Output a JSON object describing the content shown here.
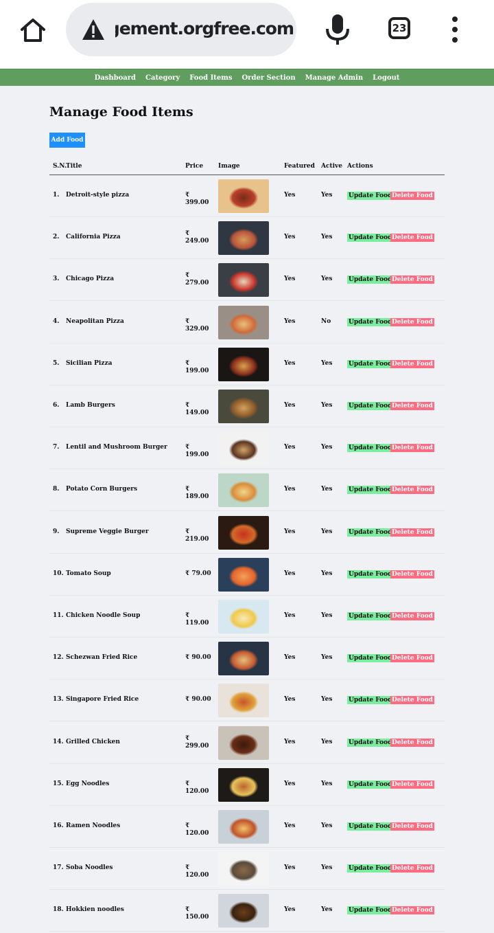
{
  "browser": {
    "url": "restaurant-management.orgfree.com",
    "tab_count": "23",
    "icons": [
      "home-icon",
      "warning-icon",
      "mic-icon",
      "tabs-icon",
      "menu-icon"
    ]
  },
  "nav": {
    "items": [
      "Dashboard",
      "Category",
      "Food Items",
      "Order Section",
      "Manage Admin",
      "Logout"
    ]
  },
  "page": {
    "title": "Manage Food Items",
    "add_button": "Add Food"
  },
  "table": {
    "headers": {
      "sn": "S.N.",
      "title": "Title",
      "price": "Price",
      "image": "Image",
      "featured": "Featured",
      "active": "Active",
      "actions": "Actions"
    },
    "update_label": "Update Food",
    "delete_label": "Delete Food",
    "rows": [
      {
        "sn": "1.",
        "title": "Detroit-style pizza",
        "price": "₹ 399.00",
        "featured": "Yes",
        "active": "Yes",
        "img": "pizza-squares"
      },
      {
        "sn": "2.",
        "title": "California Pizza",
        "price": "₹ 249.00",
        "featured": "Yes",
        "active": "Yes",
        "img": "pizza-round"
      },
      {
        "sn": "3.",
        "title": "Chicago Pizza",
        "price": "₹ 279.00",
        "featured": "Yes",
        "active": "Yes",
        "img": "deep-dish"
      },
      {
        "sn": "4.",
        "title": "Neapolitan Pizza",
        "price": "₹ 329.00",
        "featured": "Yes",
        "active": "No",
        "img": "pizza-margherita"
      },
      {
        "sn": "5.",
        "title": "Sicilian Pizza",
        "price": "₹ 199.00",
        "featured": "Yes",
        "active": "Yes",
        "img": "pizza-tray"
      },
      {
        "sn": "6.",
        "title": "Lamb Burgers",
        "price": "₹ 149.00",
        "featured": "Yes",
        "active": "Yes",
        "img": "burger-lamb"
      },
      {
        "sn": "7.",
        "title": "Lentil and Mushroom Burger",
        "price": "₹ 199.00",
        "featured": "Yes",
        "active": "Yes",
        "img": "burger-lentil"
      },
      {
        "sn": "8.",
        "title": "Potato Corn Burgers",
        "price": "₹ 189.00",
        "featured": "Yes",
        "active": "Yes",
        "img": "burger-potato"
      },
      {
        "sn": "9.",
        "title": "Supreme Veggie Burger",
        "price": "₹ 219.00",
        "featured": "Yes",
        "active": "Yes",
        "img": "burger-veggie"
      },
      {
        "sn": "10.",
        "title": "Tomato Soup",
        "price": "₹ 79.00",
        "featured": "Yes",
        "active": "Yes",
        "img": "soup-tomato"
      },
      {
        "sn": "11.",
        "title": "Chicken Noodle Soup",
        "price": "₹ 119.00",
        "featured": "Yes",
        "active": "Yes",
        "img": "soup-chicken"
      },
      {
        "sn": "12.",
        "title": "Schezwan Fried Rice",
        "price": "₹ 90.00",
        "featured": "Yes",
        "active": "Yes",
        "img": "rice-schezwan"
      },
      {
        "sn": "13.",
        "title": "Singapore Fried Rice",
        "price": "₹ 90.00",
        "featured": "Yes",
        "active": "Yes",
        "img": "rice-singapore"
      },
      {
        "sn": "14.",
        "title": "Grilled Chicken",
        "price": "₹ 299.00",
        "featured": "Yes",
        "active": "Yes",
        "img": "chicken-grilled"
      },
      {
        "sn": "15.",
        "title": "Egg Noodles",
        "price": "₹ 120.00",
        "featured": "Yes",
        "active": "Yes",
        "img": "noodles-egg"
      },
      {
        "sn": "16.",
        "title": "Ramen Noodles",
        "price": "₹ 120.00",
        "featured": "Yes",
        "active": "Yes",
        "img": "ramen"
      },
      {
        "sn": "17.",
        "title": "Soba Noodles",
        "price": "₹ 120.00",
        "featured": "Yes",
        "active": "Yes",
        "img": "soba"
      },
      {
        "sn": "18.",
        "title": "Hokkien noodles",
        "price": "₹ 150.00",
        "featured": "Yes",
        "active": "Yes",
        "img": "hokkien"
      }
    ]
  },
  "colors": {
    "nav_green": "#5f9e5f",
    "add_blue": "#1e90ff",
    "update_green": "#7bed9f",
    "delete_red": "#ff6b81"
  }
}
